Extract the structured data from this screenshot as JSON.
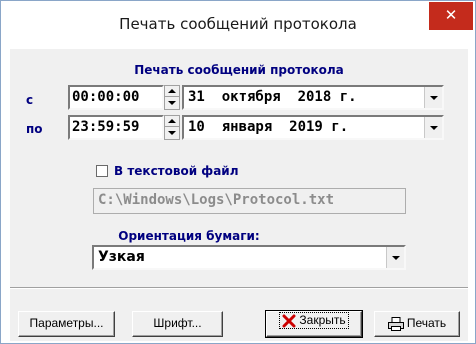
{
  "window": {
    "title": "Печать сообщений протокола",
    "close_glyph": "✕"
  },
  "section": {
    "title": "Печать сообщений протокола"
  },
  "from_row": {
    "label": "с",
    "time": "00:00:00",
    "date": "31  октября  2018 г."
  },
  "to_row": {
    "label": "по",
    "time": "23:59:59",
    "date": "10  января  2019 г."
  },
  "to_file": {
    "checked": false,
    "label": "В текстовой файл",
    "path": "C:\\Windows\\Logs\\Protocol.txt"
  },
  "orientation": {
    "label": "Ориентация бумаги:",
    "value": "Узкая"
  },
  "buttons": {
    "params": "Параметры...",
    "font": "Шрифт...",
    "close": "Закрыть",
    "print": "Печать"
  },
  "icons": {
    "close_x_color": "#cc0000",
    "title_close_bg": "#c42b1c"
  }
}
